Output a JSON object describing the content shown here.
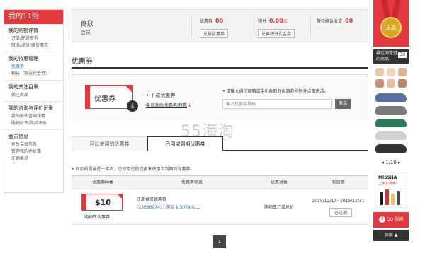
{
  "sidebar": {
    "header": "我的11街",
    "sections": [
      {
        "title": "我的购物详情",
        "items": [
          "订单/配送查询",
          "取消/退货/换货情况"
        ]
      },
      {
        "title": "我的特惠管理",
        "items": [
          "优惠券",
          "积分（积分代金券）"
        ]
      },
      {
        "title": "我的关注目录",
        "items": [
          "关注商品"
        ]
      },
      {
        "title": "我的咨询与评价记录",
        "items": [
          "我的邮件咨询详情",
          "购物好评/商品评价"
        ]
      },
      {
        "title": "会员信息",
        "items": [
          "更改会员信息",
          "管理我的地址簿",
          "注销会员"
        ]
      }
    ]
  },
  "infobar": {
    "user_name": "佟欣",
    "user_level": "会员",
    "coupon_label": "优惠券",
    "coupon_value": "00",
    "coupon_btn": "兑换优惠券",
    "points_label": "积分",
    "points_value": "0.00",
    "points_unit": "点",
    "points_btn": "兑换积分代金券",
    "pending_label": "等待确认收货",
    "pending_value": "00"
  },
  "section_title": "优惠券",
  "download": {
    "tile_text": "优惠券",
    "label": "下载优惠券",
    "links": "会员活动/优惠券/特惠",
    "register_text": "请输入通过邮箱或手机收取的优惠券号码并点击激活。",
    "input_placeholder": "输入优惠券号码",
    "register_btn": "激活"
  },
  "watermark": "55海淘",
  "tabs": [
    "可以使用的优惠券",
    "已用或到期优惠券"
  ],
  "note": "显示的是最近一年内，您使用过的或者未使用但到期的优惠券。",
  "table": {
    "headers": [
      "优惠券种类",
      "优惠券信息",
      "优惠对象",
      "有效期"
    ],
    "rows": [
      {
        "amount": "$10",
        "type": "购物车优惠券",
        "name": "注册会员优惠券",
        "detail": "[236869741] 购买 $ 30.00以上",
        "target": "购物车订单总价",
        "validity": "2015/12/17~2015/12/31",
        "status": "已过期"
      }
    ]
  },
  "pager": "1",
  "rail": {
    "medal": "正品",
    "recent_title": "最近浏览过的商品",
    "recent_count": "30",
    "pager": "1/10",
    "ad_brand": "MISSHA",
    "ad_sub": "上半年特卖!",
    "qq": "QQ 咨询",
    "qq_icon": "Q",
    "top": "顶部 ▲"
  },
  "colors": {
    "accent": "#e4393c",
    "dark": "#333333"
  }
}
